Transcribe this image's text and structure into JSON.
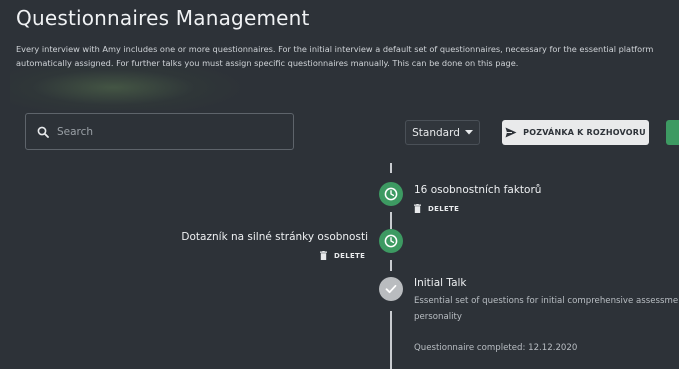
{
  "header": {
    "title": "Questionnaires Management",
    "intro_line1": "Every interview with Amy includes one or more questionnaires. For the initial interview a default set of questionnaires, necessary for the essential platform",
    "intro_line2": "automatically assigned. For further talks you must assign specific questionnaires manually. This can be done on this page."
  },
  "toolbar": {
    "search_placeholder": "Search",
    "search_value": "",
    "select_value": "Standard",
    "invite_label": "POZVÁNKA K ROZHOVORU"
  },
  "timeline": {
    "items": [
      {
        "name": "16 osobnostních faktorů",
        "delete_label": "DELETE",
        "status": "pending",
        "side": "right"
      },
      {
        "name": "Dotazník na silné stránky osobnosti",
        "delete_label": "DELETE",
        "status": "pending",
        "side": "left"
      },
      {
        "name": "Initial Talk",
        "description_line1": "Essential set of questions for initial comprehensive assessme",
        "description_line2": "personality",
        "completed": "Questionnaire completed: 12.12.2020",
        "status": "completed",
        "side": "right"
      }
    ]
  },
  "icons": {
    "search": "search-icon",
    "caret": "caret-down-icon",
    "send": "send-icon",
    "clock": "clock-icon",
    "trash": "trash-icon",
    "check": "check-icon"
  },
  "colors": {
    "background": "#2d3238",
    "accent_green": "#3d9a62",
    "completed_grey": "#b9bcbf",
    "button_light": "#e9eaeb"
  }
}
